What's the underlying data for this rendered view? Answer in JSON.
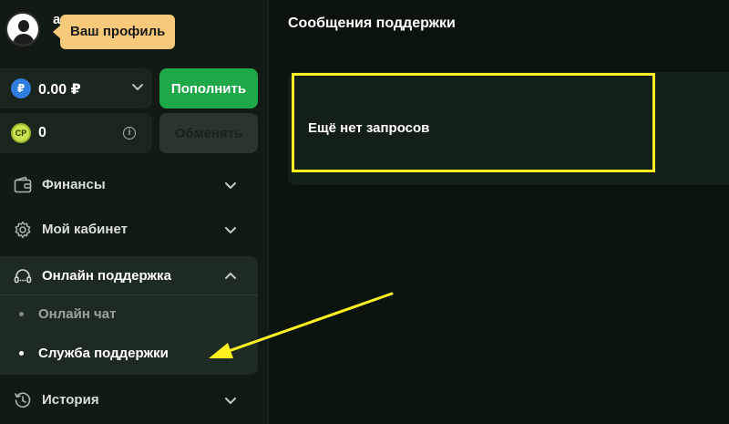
{
  "profile": {
    "username": "a",
    "tooltip": "Ваш профиль"
  },
  "balances": {
    "rub": {
      "value": "0.00 ₽",
      "coin_symbol": "₽"
    },
    "cp": {
      "value": "0",
      "coin_symbol": "CP"
    },
    "topup_label": "Пополнить",
    "exchange_label": "Обменять"
  },
  "menu": {
    "finance": "Финансы",
    "cabinet": "Мой кабинет",
    "support": "Онлайн поддержка",
    "support_sub": [
      "Онлайн чат",
      "Служба поддержки"
    ],
    "history": "История"
  },
  "main": {
    "title": "Сообщения поддержки",
    "empty_text": "Ещё нет запросов"
  },
  "colors": {
    "accent_green": "#1fa84a",
    "annotation_yellow": "#fff01f",
    "tooltip_bg": "#f7c97a"
  }
}
